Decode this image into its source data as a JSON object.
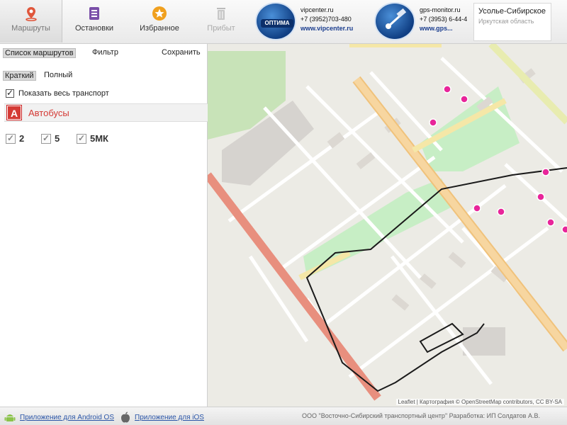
{
  "toolbar": {
    "buttons": [
      {
        "label": "Маршруты",
        "icon": "map-pin-icon",
        "color": "#e0563b",
        "active": true
      },
      {
        "label": "Остановки",
        "icon": "stops-list-icon",
        "color": "#7a4fa8"
      },
      {
        "label": "Избранное",
        "icon": "star-icon",
        "color": "#f0a01e"
      },
      {
        "label": "Прибыт",
        "icon": "trash-icon",
        "color": "#a0a0a0",
        "disabled": true
      }
    ]
  },
  "logos": {
    "left": {
      "badge": "ОПТИМА",
      "line1": "vipcenter.ru",
      "line2": "+7 (3952)703-480",
      "url": "www.vipcenter.ru"
    },
    "right": {
      "line1": "gps-monitor.ru",
      "line2": "+7 (3953) 6-44-4",
      "url": "www.gps..."
    }
  },
  "city": {
    "name": "Усолье-Сибирское",
    "region": "Иркутская область"
  },
  "sidebar": {
    "top_links": {
      "routes_list": "Список маршрутов",
      "filter": "Фильтр",
      "save": "Сохранить"
    },
    "view_mode": {
      "short": "Краткий",
      "full": "Полный"
    },
    "show_all": "Показать весь транспорт",
    "category": {
      "icon_letter": "А",
      "label": "Автобусы"
    },
    "routes": [
      "2",
      "5",
      "5МК"
    ]
  },
  "map": {
    "attribution": "Leaflet | Картография © OpenStreetMap contributors, CC BY-SA",
    "route_color": "#1a1a1a",
    "stop_color": "#e8259a"
  },
  "footer": {
    "android_link": "Приложение для Android OS",
    "ios_link": "Приложение для iOS",
    "right_text": "ООО \"Восточно-Сибирский транспортный центр\"   Разработка: ИП Солдатов А.В."
  }
}
